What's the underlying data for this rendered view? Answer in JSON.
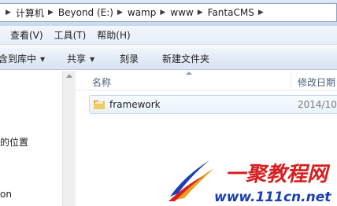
{
  "address": {
    "crumbs": [
      "计算机",
      "Beyond (E:)",
      "wamp",
      "www",
      "FantaCMS"
    ]
  },
  "menu": {
    "items": [
      "查看(V)",
      "工具(T)",
      "帮助(H)"
    ]
  },
  "toolbar": {
    "include_library": "含到库中",
    "share": "共享",
    "burn": "刻录",
    "new_folder": "新建文件夹"
  },
  "nav": {
    "items": [
      "的位置",
      "on"
    ]
  },
  "list": {
    "columns": {
      "name": "名称",
      "date_modified": "修改日期"
    },
    "rows": [
      {
        "name": "framework",
        "date": "2014/10/",
        "icon": "folder-icon"
      }
    ]
  },
  "watermark": {
    "title": "一聚教程网",
    "url": "www.111cn.net"
  },
  "colors": {
    "folder": "#e8c255",
    "selection_border": "#c6daf1",
    "watermark_red": "#d81e1e",
    "watermark_blue": "#1a3fb4"
  }
}
